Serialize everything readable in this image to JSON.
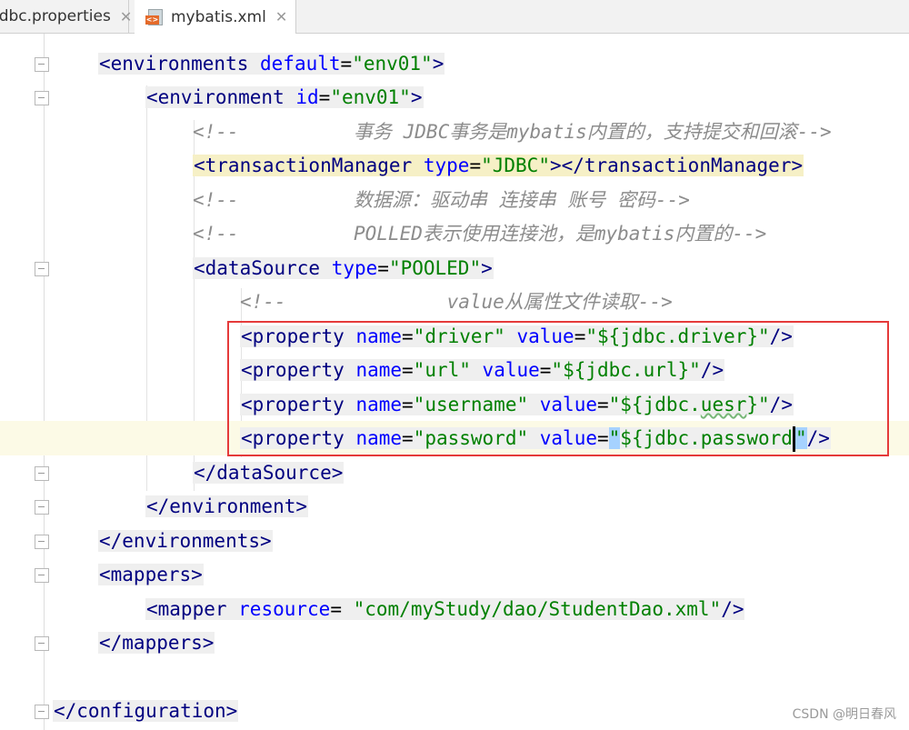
{
  "tabs": [
    {
      "label": "jdbc.properties"
    },
    {
      "label": "mybatis.xml"
    }
  ],
  "code": {
    "l1": {
      "open": "<environments ",
      "attr": "default",
      "eq": "=",
      "val": "\"env01\"",
      "close": ">"
    },
    "l2": {
      "open": "<environment ",
      "attr": "id",
      "eq": "=",
      "val": "\"env01\"",
      "close": ">"
    },
    "l3": {
      "comment": "<!--          事务 JDBC事务是mybatis内置的，支持提交和回滚-->"
    },
    "l4": {
      "open": "<transactionManager ",
      "attr": "type",
      "eq": "=",
      "val": "\"JDBC\"",
      "close": "></transactionManager>"
    },
    "l5": {
      "comment": "<!--          数据源：驱动串 连接串 账号 密码-->"
    },
    "l6": {
      "comment": "<!--          POLLED表示使用连接池，是mybatis内置的-->"
    },
    "l7": {
      "open": "<dataSource ",
      "attr": "type",
      "eq": "=",
      "val": "\"POOLED\"",
      "close": ">"
    },
    "l8": {
      "comment": "<!--              value从属性文件读取-->"
    },
    "l9": {
      "open": "<property ",
      "attr1": "name",
      "val1": "\"driver\"",
      "attr2": "value",
      "val2": "\"${jdbc.driver}\"",
      "close": "/>"
    },
    "l10": {
      "open": "<property ",
      "attr1": "name",
      "val1": "\"url\"",
      "attr2": "value",
      "val2": "\"${jdbc.url}\"",
      "close": "/>"
    },
    "l11": {
      "open": "<property ",
      "attr1": "name",
      "val1": "\"username\"",
      "attr2": "value",
      "val2a": "\"${jdbc.",
      "val2b": "uesr",
      "val2c": "}\"",
      "close": "/>"
    },
    "l12": {
      "open": "<property ",
      "attr1": "name",
      "val1": "\"password\"",
      "attr2": "value",
      "q1": "\"",
      "val2": "${jdbc.password",
      "q2": "\"",
      "close": "/>"
    },
    "l13": {
      "text": "</dataSource>"
    },
    "l14": {
      "text": "</environment>"
    },
    "l15": {
      "text": "</environments>"
    },
    "l16": {
      "text": "<mappers>"
    },
    "l17": {
      "open": "<mapper ",
      "attr": "resource",
      "eq": "= ",
      "val": "\"com/myStudy/dao/StudentDao.xml\"",
      "close": "/>"
    },
    "l18": {
      "text": "</mappers>"
    },
    "l20": {
      "text": "</configuration>"
    }
  },
  "watermark": "CSDN @明日春风"
}
